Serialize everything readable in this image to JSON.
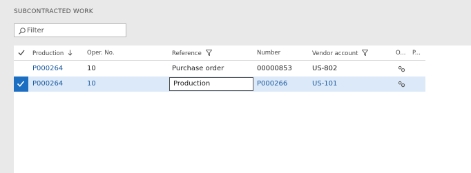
{
  "section": {
    "title": "SUBCONTRACTED WORK"
  },
  "filter": {
    "placeholder": "Filter",
    "icon": "search-icon"
  },
  "columns": [
    {
      "label": "Production",
      "sort": "descending"
    },
    {
      "label": "Oper. No."
    },
    {
      "label": "Reference",
      "filtered": true
    },
    {
      "label": "Number"
    },
    {
      "label": "Vendor account",
      "filtered": true
    },
    {
      "label": "O..."
    },
    {
      "label": "P..."
    }
  ],
  "rows": [
    {
      "production": "P000264",
      "oper_no": "10",
      "reference": "Purchase order",
      "number": "00000853",
      "vendor_account": "US-802",
      "selected": false,
      "icon": "gear-icon"
    },
    {
      "production": "P000264",
      "oper_no": "10",
      "reference": "Production",
      "number": "P000266",
      "vendor_account": "US-101",
      "selected": true,
      "icon": "gear-icon"
    }
  ],
  "colors": {
    "accent": "#1b6ec2",
    "selected_row": "#dce9f8",
    "link": "#1b5aa0"
  }
}
